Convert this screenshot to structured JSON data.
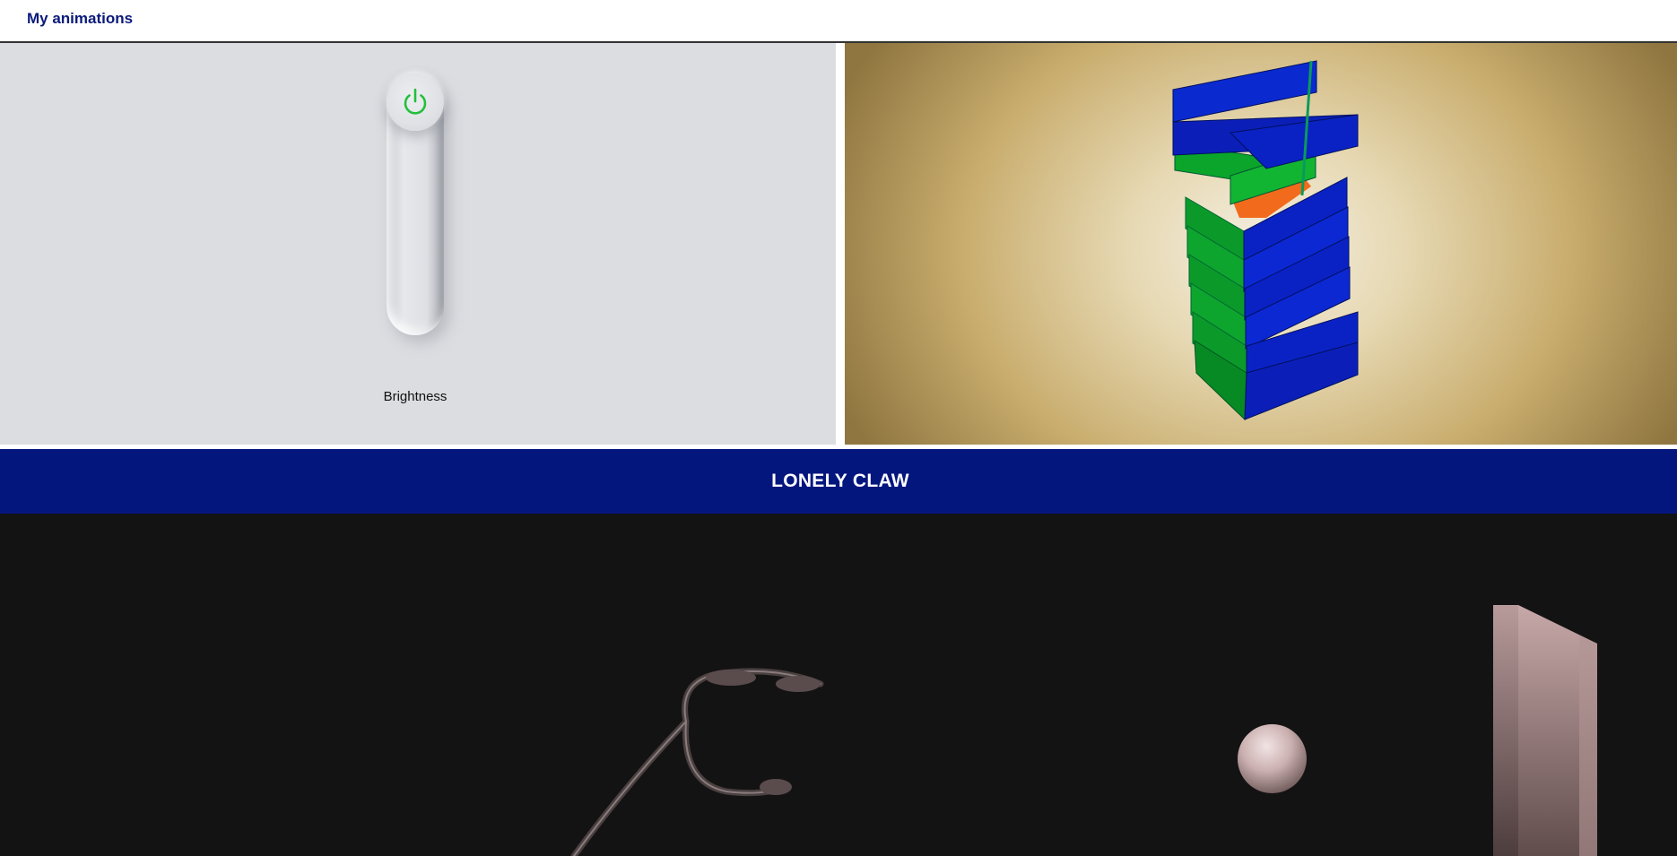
{
  "header": {
    "title": "My animations"
  },
  "brightness": {
    "label": "Brightness",
    "level": 1.0,
    "icon": "power-icon",
    "icon_color": "#22c03a"
  },
  "cube_tower": {
    "colors": {
      "green": "#0aa52a",
      "blue": "#0b28c8",
      "orange": "#f26a1b"
    }
  },
  "banner": {
    "title": "LONELY CLAW",
    "background": "#03167e"
  },
  "scene": {
    "background": "#141314",
    "objects": [
      "claw",
      "sphere",
      "wall"
    ]
  }
}
